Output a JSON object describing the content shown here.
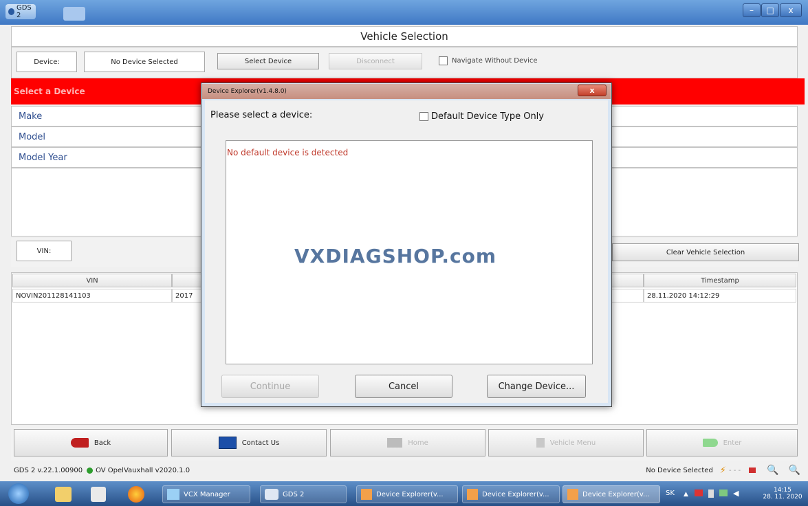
{
  "window": {
    "app_title": "GDS 2",
    "minimize": "–",
    "maximize": "□",
    "close": "x"
  },
  "header": {
    "title": "Vehicle Selection"
  },
  "device_row": {
    "device_label": "Device:",
    "device_value": "No Device Selected",
    "select_device": "Select Device",
    "disconnect": "Disconnect",
    "navigate_without_device": "Navigate Without Device"
  },
  "selection": {
    "heading": "Select a Device",
    "rows": [
      "Make",
      "Model",
      "Model Year"
    ]
  },
  "vin_row": {
    "vin_label": "VIN:",
    "clear_button": "Clear Vehicle Selection"
  },
  "history": {
    "columns": [
      "VIN",
      "Timestamp"
    ],
    "rows": [
      {
        "vin": "NOVIN201128141103",
        "year": "2017",
        "timestamp": "28.11.2020 14:12:29"
      }
    ]
  },
  "nav": {
    "back": "Back",
    "contact": "Contact Us",
    "home": "Home",
    "vehicle_menu": "Vehicle Menu",
    "enter": "Enter"
  },
  "status": {
    "version": "GDS 2 v.22.1.00900",
    "data": "OV OpelVauxhall v2020.1.0",
    "device": "No Device Selected"
  },
  "dialog": {
    "title": "Device Explorer(v1.4.8.0)",
    "close": "x",
    "prompt": "Please select a device:",
    "default_only": "Default Device Type Only",
    "message": "No default device is detected",
    "watermark": "VXDIAGSHOP.com",
    "continue": "Continue",
    "cancel": "Cancel",
    "change_device": "Change Device..."
  },
  "taskbar": {
    "tasks": [
      "VCX Manager",
      "GDS 2",
      "Device Explorer(v...",
      "Device Explorer(v...",
      "Device Explorer(v..."
    ],
    "lang": "SK",
    "time": "14:15",
    "date": "28. 11. 2020"
  },
  "colors": {
    "red_bar": "#ff0000",
    "link_blue": "#2d4d8f",
    "error_text": "#c0392b",
    "status_green": "#2e9d2e"
  }
}
